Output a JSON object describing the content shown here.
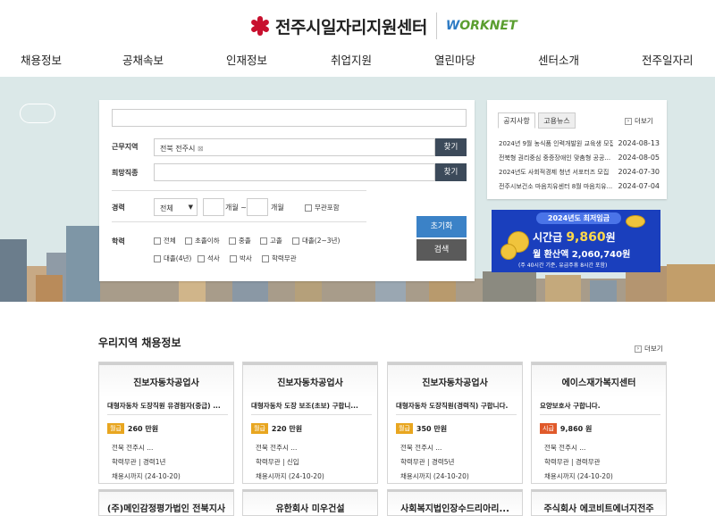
{
  "header": {
    "logo_text": "전주시일자리지원센터",
    "worknet_prefix": "W",
    "worknet_text": "ORKNET"
  },
  "nav": [
    "채용정보",
    "공채속보",
    "인재정보",
    "취업지원",
    "열린마당",
    "센터소개",
    "전주일자리"
  ],
  "search": {
    "keyword_value": "",
    "location_label": "근무지역",
    "location_value": "전북 전주시",
    "find_label": "찾기",
    "job_label": "희망직종",
    "job_value": "",
    "career_label": "경력",
    "career_select": "전체",
    "months_label1": "개월 ~",
    "months_label2": "개월",
    "career_any": "무관포함",
    "edu_label": "학력",
    "edu_options": [
      "전체",
      "초졸이하",
      "중졸",
      "고졸",
      "대졸(2~3년)",
      "대졸(4년)",
      "석사",
      "박사",
      "학력무관"
    ],
    "reset": "초기화",
    "submit": "검색"
  },
  "notice": {
    "tabs": [
      "공지사항",
      "고용뉴스"
    ],
    "more": "더보기",
    "items": [
      {
        "title": "2024년 9월 농식품 인력개발원 교육생 모집",
        "date": "2024-08-13"
      },
      {
        "title": "전북형 권리중심 중증장애인 맞춤형 공공...",
        "date": "2024-08-05"
      },
      {
        "title": "2024년도 사회적경제 청년 서포터즈 모집",
        "date": "2024-07-30"
      },
      {
        "title": "전주시보건소 마음치유센터 8월 마음치유...",
        "date": "2024-07-04"
      }
    ]
  },
  "banner": {
    "pill": "2024년도 최저임금",
    "hourly_prefix": "시간급",
    "hourly": "9,860",
    "hourly_unit": "원",
    "monthly_prefix": "월 환산액",
    "monthly": "2,060,740원",
    "note": "(주 40시간 기준, 유급주휴 8시간 포함)"
  },
  "jobs_section": {
    "title": "우리지역 채용정보",
    "more": "더보기",
    "cards": [
      {
        "company": "진보자동차공업사",
        "job": "대형자동차 도장직원 유경험자(중급) ...",
        "pay_tag": "월급",
        "pay": "260 만원",
        "location": "전북 전주시 ...",
        "req": "학력무관 | 경력1년",
        "deadline": "채용시까지 (24-10-20)"
      },
      {
        "company": "진보자동차공업사",
        "job": "대형자동차 도장 보조(초보) 구합니...",
        "pay_tag": "월급",
        "pay": "220 만원",
        "location": "전북 전주시 ...",
        "req": "학력무관 | 신입",
        "deadline": "채용시까지 (24-10-20)"
      },
      {
        "company": "진보자동차공업사",
        "job": "대형자동차 도장직원(경력직) 구합니다.",
        "pay_tag": "월급",
        "pay": "350 만원",
        "location": "전북 전주시 ...",
        "req": "학력무관 | 경력5년",
        "deadline": "채용시까지 (24-10-20)"
      },
      {
        "company": "에이스재가복지센터",
        "job": "요양보호사 구합니다.",
        "pay_tag": "시급",
        "pay": "9,860 원",
        "location": "전북 전주시 ...",
        "req": "학력무관 | 경력무관",
        "deadline": "채용시까지 (24-10-20)"
      }
    ],
    "next_row": [
      "(주)메인감정평가법인 전북지사",
      "유한회사 미우건설",
      "사회복지법인장수드리아리...",
      "주식회사 에코비트에너지전주"
    ]
  },
  "colors": {
    "accent_blue": "#3b82c7",
    "dark_button": "#3c4a5a",
    "monthly_tag": "#e8a620",
    "hourly_tag": "#e05a2b",
    "banner_bg": "#1a3fbd"
  }
}
